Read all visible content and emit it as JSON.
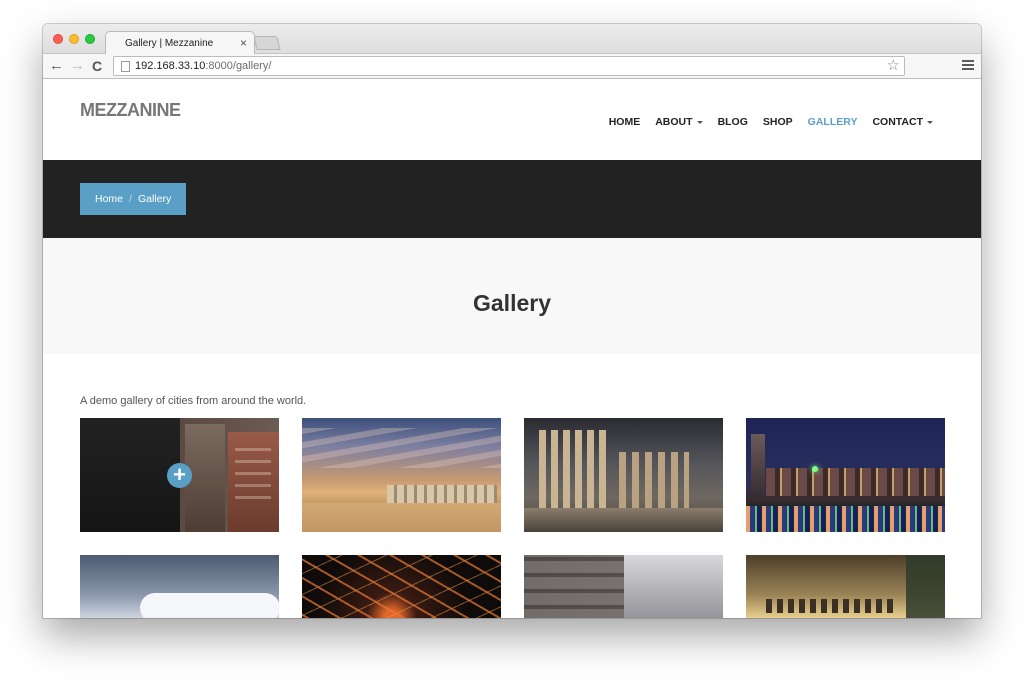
{
  "browser": {
    "tab_title": "Gallery | Mezzanine",
    "tab_close": "×",
    "url_host": "192.168.33.10",
    "url_rest": ":8000/gallery/",
    "back_icon": "←",
    "forward_icon": "→",
    "reload_icon": "C",
    "star_icon": "☆"
  },
  "site": {
    "brand": "MEZZANINE",
    "nav": [
      {
        "label": "HOME",
        "active": false,
        "dropdown": false
      },
      {
        "label": "ABOUT",
        "active": false,
        "dropdown": true
      },
      {
        "label": "BLOG",
        "active": false,
        "dropdown": false
      },
      {
        "label": "SHOP",
        "active": false,
        "dropdown": false
      },
      {
        "label": "GALLERY",
        "active": true,
        "dropdown": false
      },
      {
        "label": "CONTACT",
        "active": false,
        "dropdown": true
      }
    ],
    "breadcrumb": {
      "home": "Home",
      "separator": "/",
      "current": "Gallery"
    },
    "page_title": "Gallery",
    "intro": "A demo gallery of cities from around the world.",
    "gallery_hover_icon": "+"
  },
  "colors": {
    "accent": "#5a9fc6",
    "active_nav": "#5b9fc5",
    "breadcrumb_bar": "#222222",
    "title_band": "#f8f8f8"
  }
}
